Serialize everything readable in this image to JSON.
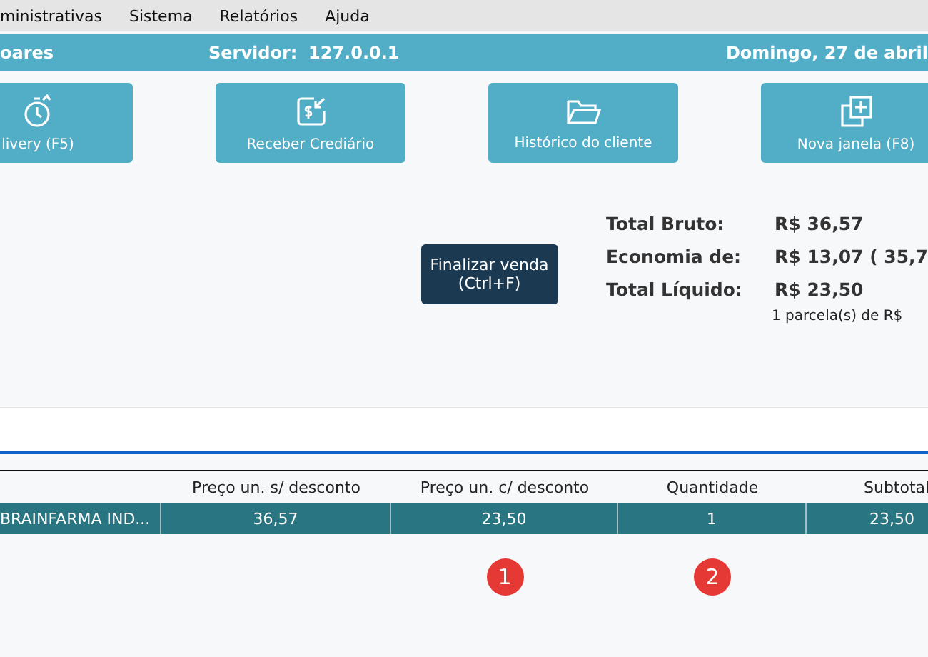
{
  "menu": [
    "ministrativas",
    "Sistema",
    "Relatórios",
    "Ajuda"
  ],
  "status_bar": {
    "user": "oares",
    "server_label": "Servidor:",
    "server": "127.0.0.1",
    "date": "Domingo, 27 de abril"
  },
  "actions": [
    {
      "label": "livery (F5)",
      "kind": "stopwatch"
    },
    {
      "label": "Receber Crediário",
      "kind": "money"
    },
    {
      "label": "Histórico do cliente",
      "kind": "folder"
    },
    {
      "label": "Nova janela (F8)",
      "kind": "window"
    }
  ],
  "finalize_button": [
    "Finalizar venda",
    "(Ctrl+F)"
  ],
  "totals": [
    {
      "label": "Total Bruto:",
      "value": "R$ 36,57"
    },
    {
      "label": "Economia de:",
      "value": "R$ 13,07 ( 35,7"
    },
    {
      "label": "Total Líquido:",
      "value": "R$ 23,50"
    }
  ],
  "installments": "1 parcela(s) de R$",
  "table": {
    "columns": [
      "",
      "Preço un. s/ desconto",
      "Preço un. c/ desconto",
      "Quantidade",
      "Subtotal"
    ],
    "rows": [
      {
        "selected": true,
        "cells": [
          "BRAINFARMA IND...",
          "36,57",
          "23,50",
          "1",
          "23,50"
        ]
      }
    ]
  },
  "markers": [
    "1",
    "2"
  ]
}
